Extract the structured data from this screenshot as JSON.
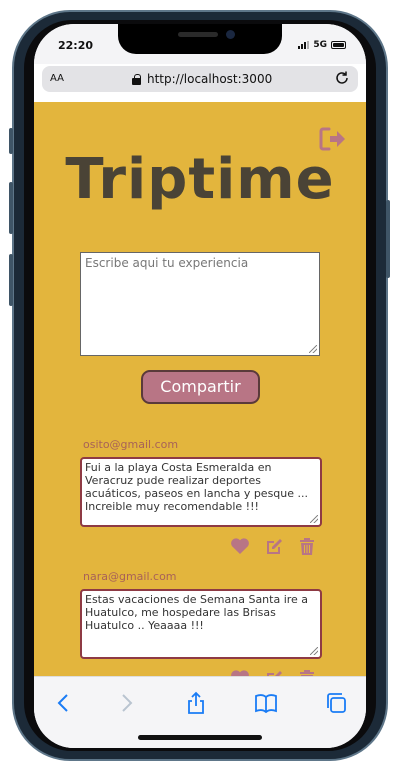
{
  "status": {
    "time": "22:20",
    "network": "5G"
  },
  "browser": {
    "text_size_label": "AA",
    "url": "http://localhost:3000"
  },
  "app": {
    "title": "Triptime",
    "composer_placeholder": "Escribe aqui tu experiencia",
    "share_label": "Compartir"
  },
  "posts": [
    {
      "email": "osito@gmail.com",
      "text": "Fui a la playa Costa Esmeralda en Veracruz pude realizar deportes acuáticos, paseos en lancha y  pesque ... Increible muy recomendable !!!"
    },
    {
      "email": "nara@gmail.com",
      "text": "Estas vacaciones de Semana Santa ire a Huatulco, me hospedare las Brisas Huatulco .. Yeaaaa !!!"
    }
  ],
  "icons": {
    "logout": "logout-icon",
    "like": "heart-icon",
    "edit": "edit-icon",
    "delete": "trash-icon"
  },
  "colors": {
    "background": "#e3b53d",
    "accent": "#b87585",
    "title": "#4a4336",
    "post_border": "#8e3a44",
    "ios_blue": "#1a7cf5"
  }
}
